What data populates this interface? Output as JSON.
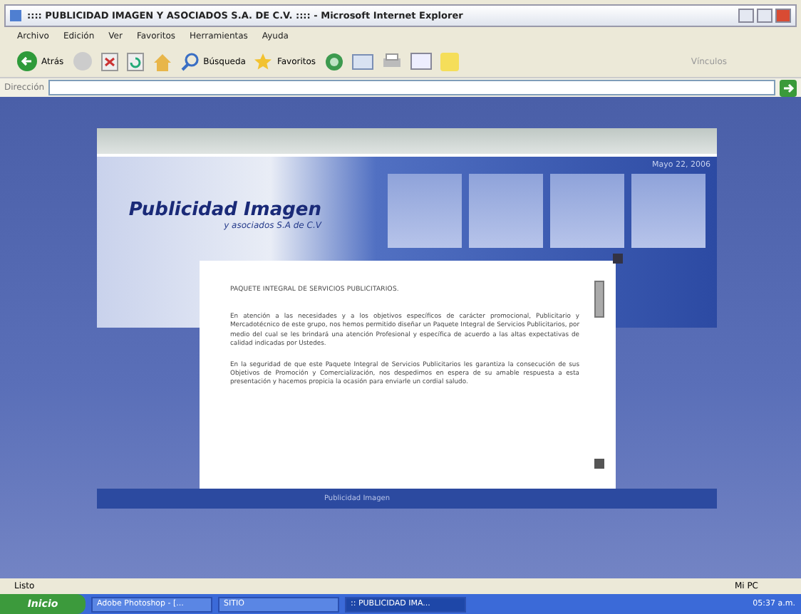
{
  "window": {
    "title": ":::: PUBLICIDAD IMAGEN Y ASOCIADOS S.A. DE C.V. :::: - Microsoft Internet Explorer"
  },
  "menu": [
    "Archivo",
    "Edición",
    "Ver",
    "Favoritos",
    "Herramientas",
    "Ayuda"
  ],
  "toolbar": {
    "back": "Atrás",
    "search": "Búsqueda",
    "favorites": "Favoritos",
    "links": "Vínculos"
  },
  "address": {
    "label": "Dirección"
  },
  "site": {
    "date": "Mayo 22, 2006",
    "logo_title": "Publicidad Imagen",
    "logo_subtitle": "y asociados S.A de C.V",
    "footer": "Publicidad Imagen"
  },
  "panel": {
    "heading": "PAQUETE INTEGRAL DE SERVICIOS PUBLICITARIOS.",
    "paragraphs": [
      "En atención a las necesidades y a los objetivos específicos de carácter promocional, Publicitario y Mercadotécnico de este grupo, nos hemos permitido diseñar un Paquete Integral de Servicios Publicitarios, por medio del cual se les brindará una atención Profesional y específica de acuerdo a las altas expectativas de calidad indicadas por Ustedes.",
      "En la seguridad de que este Paquete Integral de Servicios Publicitarios les garantiza la consecución de sus Objetivos de Promoción y Comercialización, nos despedimos en espera de su amable respuesta a esta presentación y hacemos propicia la ocasión para enviarle un cordial saludo."
    ]
  },
  "status_bar": {
    "left": "Listo",
    "right": "Mi PC"
  },
  "taskbar": {
    "start": "Inicio",
    "tasks": [
      {
        "label": "Adobe Photoshop - [...",
        "selected": false
      },
      {
        "label": "SITIO",
        "selected": false
      },
      {
        "label": ":: PUBLICIDAD IMA...",
        "selected": true
      }
    ],
    "clock": "05:37 a.m."
  }
}
